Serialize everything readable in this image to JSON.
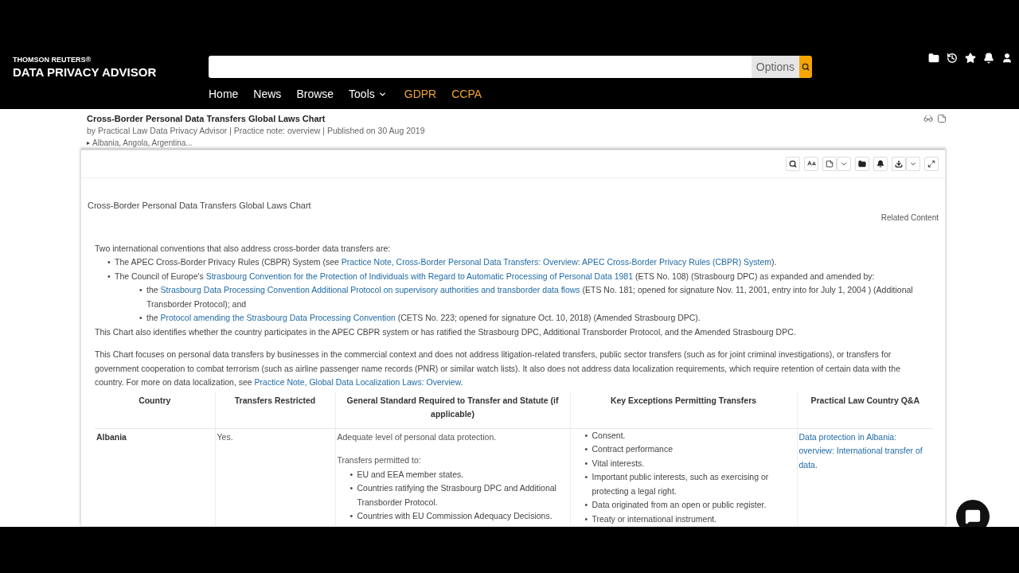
{
  "header": {
    "brand_top": "THOMSON REUTERS®",
    "brand": "DATA PRIVACY ADVISOR",
    "search": {
      "options_label": "Options"
    },
    "nav": [
      {
        "label": "Home",
        "kind": "link"
      },
      {
        "label": "News",
        "kind": "link"
      },
      {
        "label": "Browse",
        "kind": "link"
      },
      {
        "label": "Tools",
        "kind": "menu"
      },
      {
        "label": "GDPR",
        "kind": "featured"
      },
      {
        "label": "CCPA",
        "kind": "featured"
      }
    ]
  },
  "document": {
    "title": "Cross-Border Personal Data Transfers Global Laws Chart",
    "byline": "by Practical Law Data Privacy Advisor | Practice note: overview | Published on 30 Aug 2019",
    "jurisdictions_toggle": "▸",
    "jurisdictions": "Albania, Angola, Argentina...",
    "content_title": "Cross-Border Personal Data Transfers Global Laws Chart",
    "related_content": "Related Content",
    "intro": "Two international conventions that also address cross-border data transfers are:",
    "conventions": [
      {
        "marker": "•",
        "segments": [
          {
            "text": "The APEC Cross-Border Privacy Rules (CBPR) System (see "
          },
          {
            "link": "Practice Note, Cross-Border Personal Data Transfers: Overview: APEC Cross-Border Privacy Rules (CBPR) System"
          },
          {
            "text": ")."
          }
        ]
      },
      {
        "marker": "•",
        "segments": [
          {
            "text": "The Council of Europe's "
          },
          {
            "link": "Strasbourg Convention for the Protection of Individuals with Regard to Automatic Processing of Personal Data 1981"
          },
          {
            "text": " (ETS No. 108) (Strasbourg DPC) as expanded and amended by:"
          }
        ],
        "children": [
          {
            "marker": "•",
            "segments": [
              {
                "text": "the "
              },
              {
                "link": "Strasbourg Data Processing Convention Additional Protocol on supervisory authorities and transborder data flows"
              },
              {
                "text": " (ETS No. 181; opened for signature Nov. 11, 2001, entry into for July 1, 2004 ) (Additional Transborder Protocol); and"
              }
            ]
          },
          {
            "marker": "•",
            "segments": [
              {
                "text": "the "
              },
              {
                "link": "Protocol amending the Strasbourg Data Processing Convention"
              },
              {
                "text": " (CETS No. 223; opened for signature Oct. 10, 2018) (Amended Strasbourg DPC)."
              }
            ]
          }
        ]
      }
    ],
    "paragraphs": [
      {
        "segments": [
          {
            "text": "This Chart also identifies whether the country participates in the APEC CBPR system or has ratified the Strasbourg DPC, Additional Transborder Protocol, and the Amended Strasbourg DPC."
          }
        ]
      },
      {
        "segments": [
          {
            "text": "This Chart focuses on personal data transfers by businesses in the commercial context and does not address litigation-related transfers, public sector transfers (such as for joint criminal investigations), or transfers for government cooperation to combat terrorism (such as airline passenger name records (PNR) or similar watch lists). It also does not address data localization requirements, which require retention of certain data with the country. For more on data localization, see "
          },
          {
            "link": "Practice Note, Global Data Localization Laws: Overview"
          },
          {
            "text": "."
          }
        ]
      }
    ],
    "table": {
      "columns": [
        "Country",
        "Transfers Restricted",
        "General Standard Required to Transfer and Statute (if applicable)",
        "Key Exceptions Permitting Transfers",
        "Practical Law Country Q&A"
      ],
      "rows": [
        {
          "country": "Albania",
          "restricted": "Yes.",
          "standard": "Adequate level of personal data protection.",
          "permitted_intro": "Transfers permitted to:",
          "permitted": [
            {
              "marker": "•",
              "text": "EU and EEA member states."
            },
            {
              "marker": "•",
              "text": "Countries ratifying the Strasbourg DPC and Additional Transborder Protocol."
            },
            {
              "marker": "•",
              "text": "Countries with EU Commission Adequacy Decisions."
            }
          ],
          "exceptions": [
            {
              "marker": "•",
              "text": "Consent."
            },
            {
              "marker": "•",
              "text": "Contract performance"
            },
            {
              "marker": "•",
              "text": "Vital interests."
            },
            {
              "marker": "•",
              "text": "Important public interests, such as exercising or protecting a legal right."
            },
            {
              "marker": "•",
              "text": "Data originated from an open or public register."
            },
            {
              "marker": "•",
              "text": "Treaty or international instrument."
            }
          ],
          "qa": "Data protection in Albania: overview: International transfer of data."
        }
      ]
    }
  }
}
